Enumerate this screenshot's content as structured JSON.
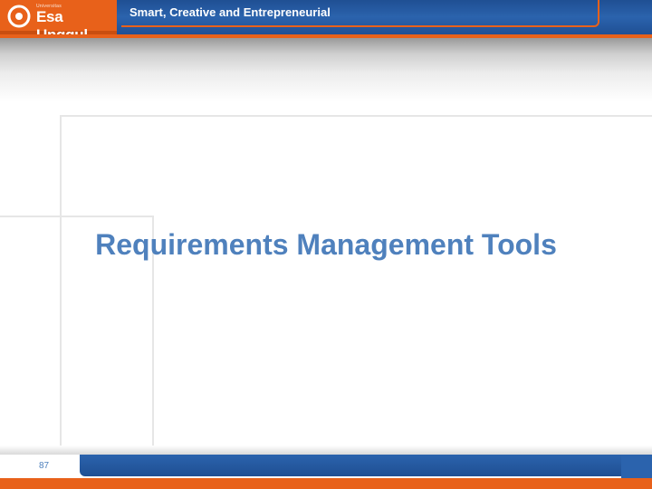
{
  "header": {
    "logo_small": "Universitas",
    "logo_text": "Esa Unggul",
    "tagline": "Smart, Creative and Entrepreneurial"
  },
  "slide": {
    "title": "Requirements Management Tools",
    "page_number": "87"
  },
  "colors": {
    "brand_blue": "#2b63ad",
    "brand_orange": "#e8611a",
    "title_blue": "#4f81bd"
  }
}
